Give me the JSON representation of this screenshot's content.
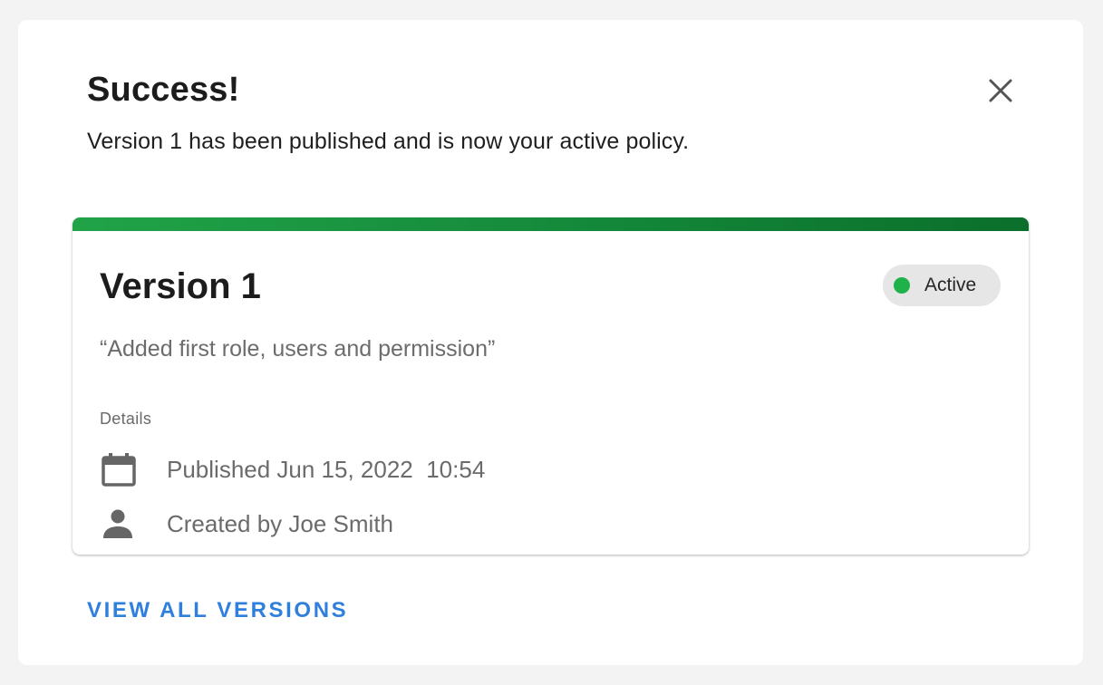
{
  "dialog": {
    "title": "Success!",
    "message": "Version 1 has been published and is now your active policy.",
    "close_icon": "close-icon"
  },
  "version_card": {
    "title": "Version 1",
    "description": "“Added first role, users and permission”",
    "status": {
      "label": "Active",
      "color": "#1fb14a"
    },
    "details_label": "Details",
    "published": {
      "icon": "calendar-icon",
      "text": "Published Jun 15, 2022  10:54"
    },
    "created": {
      "icon": "person-icon",
      "text": "Created by Joe Smith"
    },
    "accent_color": "#14883a"
  },
  "actions": {
    "view_all_label": "VIEW ALL VERSIONS",
    "link_color": "#2f7fdc"
  }
}
